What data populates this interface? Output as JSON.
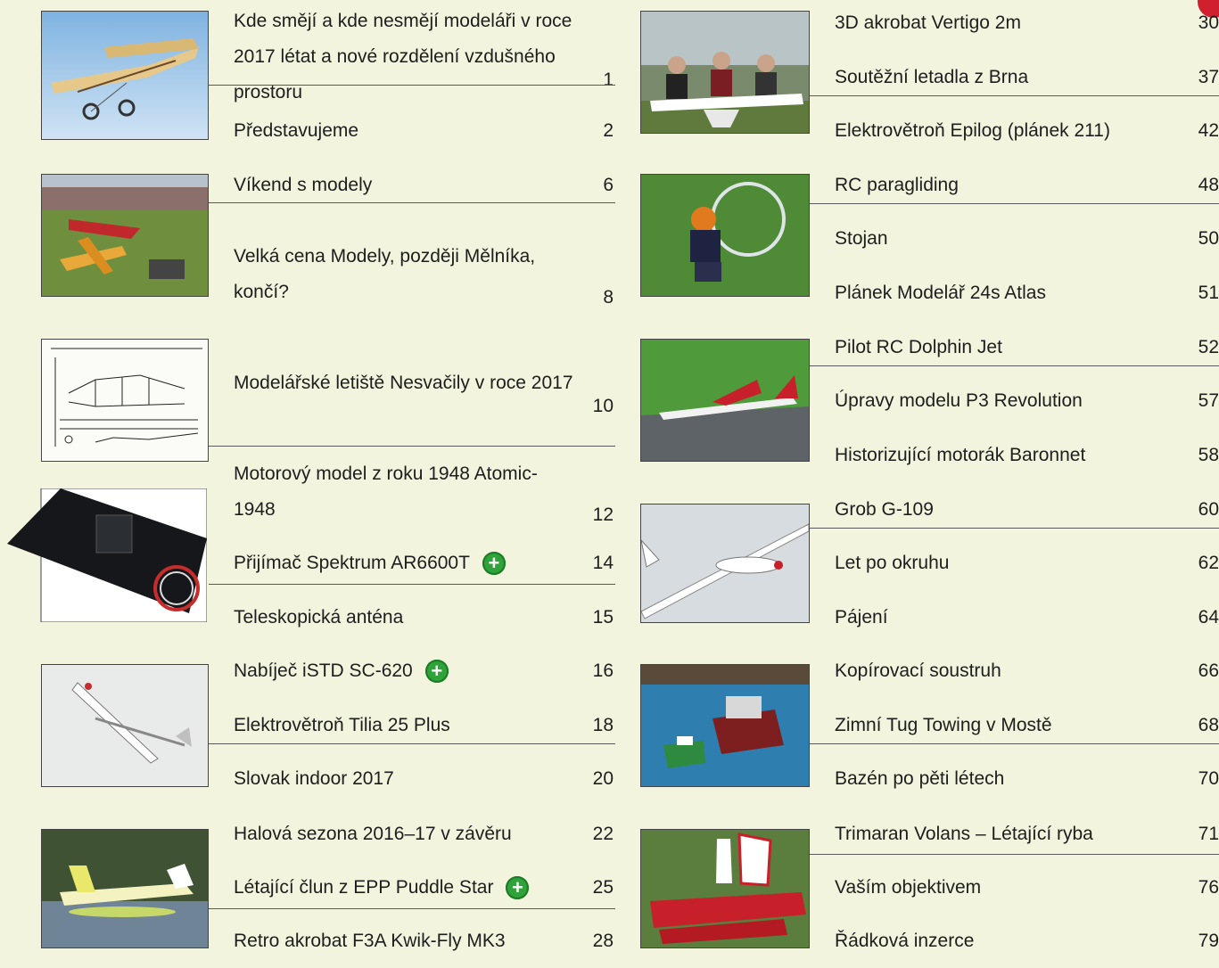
{
  "colors": {
    "accent_plus": "#2fa33a",
    "rule": "#5a5a5a",
    "background": "#f2f4de",
    "marker": "#d1202d"
  },
  "left": {
    "entries": [
      {
        "title": "Kde smějí a kde nesmějí modeláři v roce 2017 létat a nové rozdělení vzdušného prostoru",
        "page": "1"
      },
      {
        "title": "Představujeme",
        "page": "2"
      },
      {
        "title": "Víkend s modely",
        "page": "6"
      },
      {
        "title": "Velká cena Modely, později Mělníka, končí?",
        "page": "8"
      },
      {
        "title": "Modelářské letiště Nesvačily v roce 2017",
        "page": "10"
      },
      {
        "title": "Motorový model z roku 1948 Atomic-1948",
        "page": "12"
      },
      {
        "title": "Přijímač Spektrum AR6600T",
        "page": "14"
      },
      {
        "title": "Teleskopická anténa",
        "page": "15"
      },
      {
        "title": "Nabíječ iSTD SC-620",
        "page": "16"
      },
      {
        "title": "Elektrovětroň Tilia 25 Plus",
        "page": "18"
      },
      {
        "title": "Slovak indoor 2017",
        "page": "20"
      },
      {
        "title": "Halová sezona 2016–17 v závěru",
        "page": "22"
      },
      {
        "title": "Létající člun z EPP Puddle Star",
        "page": "25"
      },
      {
        "title": "Retro akrobat F3A Kwik-Fly MK3",
        "page": "28"
      }
    ]
  },
  "right": {
    "entries": [
      {
        "title": "3D akrobat Vertigo 2m",
        "page": "30"
      },
      {
        "title": "Soutěžní letadla z Brna",
        "page": "37"
      },
      {
        "title": "Elektrovětroň Epilog (plánek 211)",
        "page": "42"
      },
      {
        "title": "RC paragliding",
        "page": "48"
      },
      {
        "title": "Stojan",
        "page": "50"
      },
      {
        "title": "Plánek Modelář 24s Atlas",
        "page": "51"
      },
      {
        "title": "Pilot RC Dolphin Jet",
        "page": "52"
      },
      {
        "title": "Úpravy modelu P3 Revolution",
        "page": "57"
      },
      {
        "title": "Historizující motorák Baronnet",
        "page": "58"
      },
      {
        "title": "Grob G-109",
        "page": "60"
      },
      {
        "title": "Let po okruhu",
        "page": "62"
      },
      {
        "title": "Pájení",
        "page": "64"
      },
      {
        "title": "Kopírovací soustruh",
        "page": "66"
      },
      {
        "title": "Zimní Tug Towing v Mostě",
        "page": "68"
      },
      {
        "title": "Bazén po pěti létech",
        "page": "70"
      },
      {
        "title": "Trimaran Volans – Létající ryba",
        "page": "71"
      },
      {
        "title": "Vaším objektivem",
        "page": "76"
      },
      {
        "title": "Řádková inzerce",
        "page": "79"
      }
    ]
  }
}
